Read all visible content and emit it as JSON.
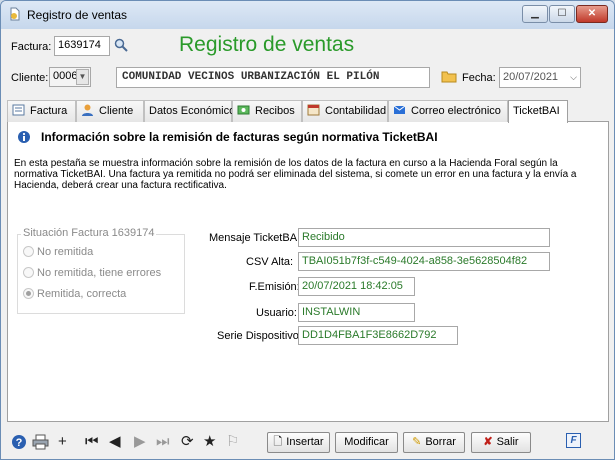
{
  "window": {
    "title": "Registro de ventas",
    "heading": "Registro de ventas"
  },
  "factura": {
    "label": "Factura:",
    "value": "1639174"
  },
  "cliente": {
    "label": "Cliente:",
    "code": "0006",
    "name": "COMUNIDAD VECINOS URBANIZACIÓN EL PILÓN"
  },
  "fecha": {
    "label": "Fecha:",
    "value": "20/07/2021"
  },
  "tabs": [
    {
      "label": "Factura",
      "icon": "invoice-icon"
    },
    {
      "label": "Cliente",
      "icon": "person-icon"
    },
    {
      "label": "Datos Económicos",
      "icon": ""
    },
    {
      "label": "Recibos",
      "icon": "receipts-icon"
    },
    {
      "label": "Contabilidad",
      "icon": "ledger-icon"
    },
    {
      "label": "Correo electrónico",
      "icon": "mail-icon"
    },
    {
      "label": "TicketBAI",
      "icon": ""
    }
  ],
  "panel": {
    "heading": "Información sobre la remisión de facturas según normativa TicketBAI",
    "description": "En esta pestaña se muestra información sobre la remisión de los datos de la factura en curso a la Hacienda Foral según la normativa TicketBAI. Una factura ya remitida no podrá ser eliminada del sistema, si comete un error en una factura y la envía a Hacienda, deberá crear una factura rectificativa.",
    "situacion": {
      "title": "Situación Factura 1639174",
      "options": [
        "No remitida",
        "No remitida, tiene errores",
        "Remitida, correcta"
      ],
      "selected": 2
    },
    "fields": [
      {
        "label": "Mensaje TicketBAI:",
        "value": "Recibido"
      },
      {
        "label": "CSV Alta:",
        "value": "TBAI051b7f3f-c549-4024-a858-3e5628504f82"
      },
      {
        "label": "F.Emisión:",
        "value": "20/07/2021 18:42:05"
      },
      {
        "label": "Usuario:",
        "value": "INSTALWIN"
      },
      {
        "label": "Serie Dispositivo:",
        "value": "DD1D4FBA1F3E8662D792"
      }
    ]
  },
  "footer": {
    "insertar": "Insertar",
    "modificar": "Modificar",
    "borrar": "Borrar",
    "salir": "Salir",
    "f_label": "F"
  }
}
